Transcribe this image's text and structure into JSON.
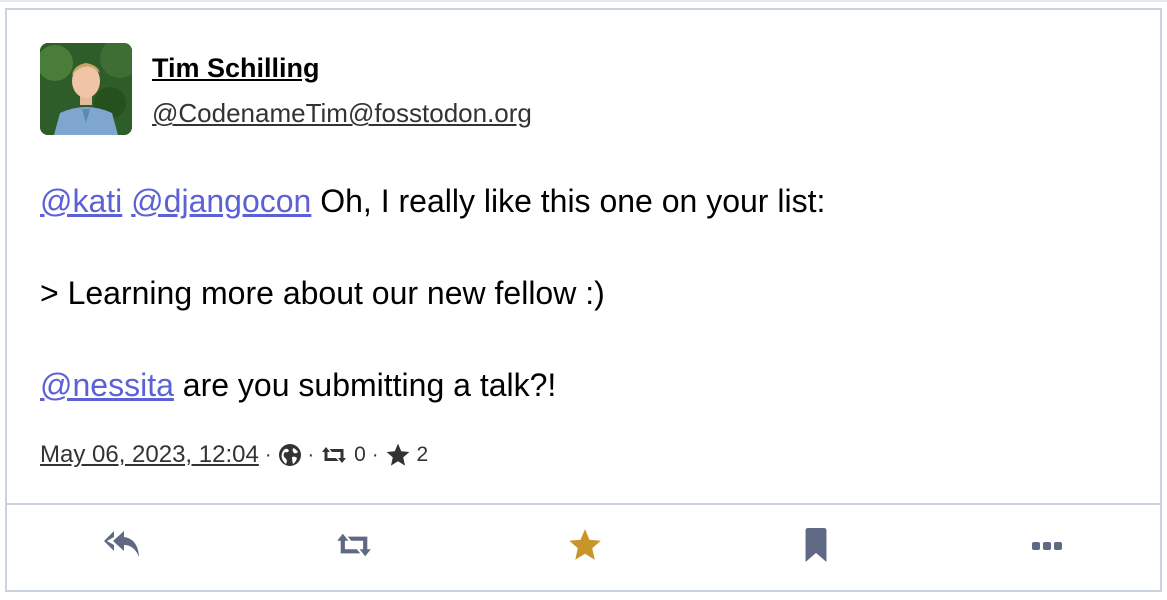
{
  "post": {
    "author": {
      "display_name": "Tim Schilling",
      "account": "@CodenameTim@fosstodon.org"
    },
    "content": {
      "p1": {
        "mention1": "@kati",
        "mention2": "@djangocon",
        "text": " Oh, I really like this one on your list:"
      },
      "p2": {
        "text": "> Learning more about our new fellow :)"
      },
      "p3": {
        "mention": "@nessita",
        "text": " are you submitting a talk?!"
      }
    },
    "meta": {
      "date": "May 06, 2023, 12:04",
      "separator": "·",
      "visibility_icon": "globe-icon",
      "boosts": "0",
      "favourites": "2"
    },
    "actions": {
      "reply_icon": "reply-all-icon",
      "boost_icon": "retweet-icon",
      "favourite_icon": "star-icon",
      "bookmark_icon": "bookmark-icon",
      "more_icon": "ellipsis-icon"
    },
    "colors": {
      "link": "#5c62d6",
      "favourite_active": "#c9952b",
      "icon": "#606984"
    }
  }
}
